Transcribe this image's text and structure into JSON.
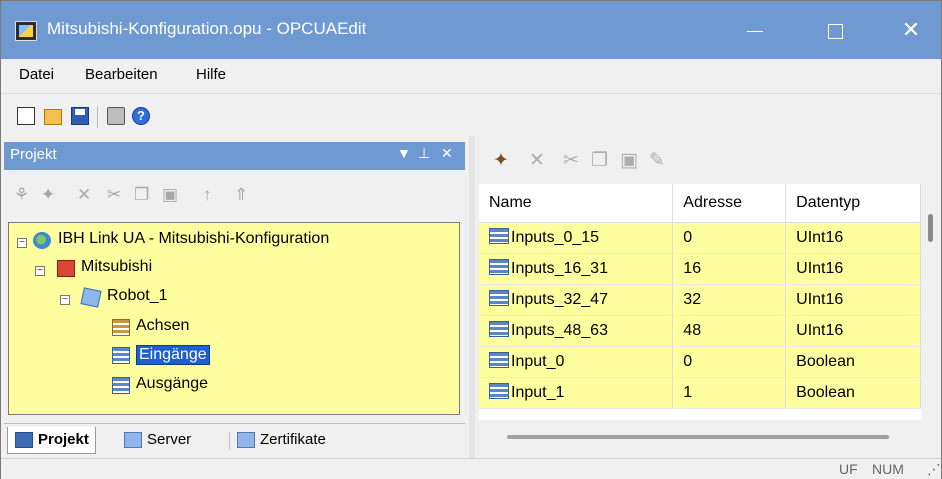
{
  "window": {
    "title": "Mitsubishi-Konfiguration.opu - OPCUAEdit"
  },
  "menu": [
    "Datei",
    "Bearbeiten",
    "Hilfe"
  ],
  "toolbar": {
    "icons": [
      "new-document-icon",
      "open-folder-icon",
      "save-disk-icon",
      "print-icon",
      "help-icon"
    ]
  },
  "left_panel": {
    "title": "Projekt",
    "tree": [
      {
        "label": "IBH Link UA - Mitsubishi-Konfiguration",
        "icon": "globe-icon"
      },
      {
        "label": "Mitsubishi",
        "icon": "plc-icon"
      },
      {
        "label": "Robot_1",
        "icon": "robot-icon"
      },
      {
        "label": "Achsen",
        "icon": "table-icon"
      },
      {
        "label": "Eingänge",
        "icon": "table-icon",
        "selected": true
      },
      {
        "label": "Ausgänge",
        "icon": "table-icon"
      }
    ],
    "tabs": [
      "Projekt",
      "Server",
      "Zertifikate"
    ]
  },
  "grid": {
    "columns": [
      "Name",
      "Adresse",
      "Datentyp"
    ],
    "rows": [
      [
        "Inputs_0_15",
        "0",
        "UInt16"
      ],
      [
        "Inputs_16_31",
        "16",
        "UInt16"
      ],
      [
        "Inputs_32_47",
        "32",
        "UInt16"
      ],
      [
        "Inputs_48_63",
        "48",
        "UInt16"
      ],
      [
        "Input_0",
        "0",
        "Boolean"
      ],
      [
        "Input_1",
        "1",
        "Boolean"
      ]
    ]
  },
  "status": {
    "uf": "UF",
    "num": "NUM"
  },
  "colors": {
    "accent": "#6f9ad1",
    "tree_background": "#ffff9f",
    "selection": "#1c5fd2"
  }
}
